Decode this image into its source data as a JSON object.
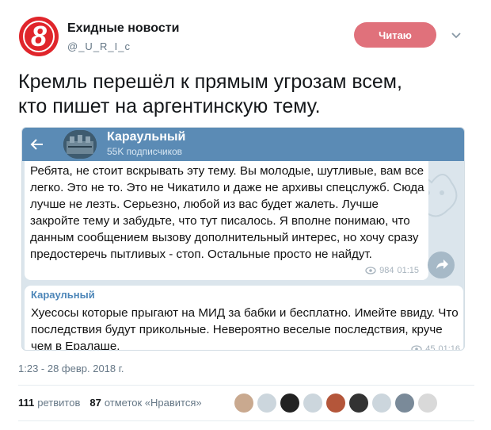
{
  "author": {
    "display_name": "Ехидные новости",
    "handle": "@_U_R_I_c",
    "logo_text": "8"
  },
  "follow_button": {
    "label": "Читаю"
  },
  "tweet": {
    "line1": "Кремль перешёл к прямым угрозам всем,",
    "line2": "кто пишет на аргентинскую тему."
  },
  "media": {
    "channel_title": "Караульный",
    "subscribers": "55K подписчиков",
    "message1": {
      "text": "Ребята, не стоит вскрывать эту тему. Вы молодые, шутливые, вам все легко. Это не то. Это не Чикатило и даже не архивы спецслужб. Сюда лучше не лезть. Серьезно, любой из вас будет жалеть. Лучше закройте тему и забудьте, что тут писалось. Я вполне понимаю, что данным сообщением вызову дополнительный интерес, но хочу сразу предостеречь пытливых - стоп. Остальные просто не найдут.",
      "views": "984",
      "time": "01:15"
    },
    "message2": {
      "author": "Караульный",
      "text": "Хуесосы которые прыгают на МИД за бабки и бесплатно. Имейте ввиду. Что последствия будут прикольные. Невероятно веселые последствия, круче чем в Ералаше.",
      "views": "45",
      "time": "01:16"
    }
  },
  "timestamp": "1:23 - 28 февр. 2018 г.",
  "stats": {
    "retweets_count": "111",
    "retweets_label": "ретвитов",
    "likes_count": "87",
    "likes_label": "отметок «Нравится»"
  },
  "colors": {
    "follow_button": "#e0717b",
    "telegram_bar": "#5b8bb5",
    "logo_red": "#e0252b"
  }
}
